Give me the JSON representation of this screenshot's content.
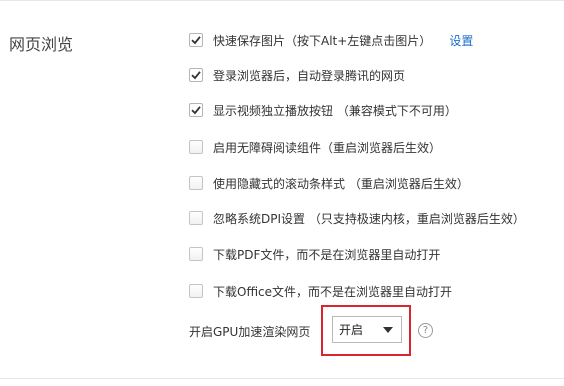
{
  "section": {
    "title": "网页浏览"
  },
  "options": [
    {
      "label": "快速保存图片（按下Alt+左键点击图片）",
      "checked": true,
      "link": "设置"
    },
    {
      "label": "登录浏览器后，自动登录腾讯的网页",
      "checked": true
    },
    {
      "label": "显示视频独立播放按钮 （兼容模式下不可用）",
      "checked": true
    },
    {
      "label": "启用无障碍阅读组件（重启浏览器后生效）",
      "checked": false
    },
    {
      "label": "使用隐藏式的滚动条样式 （重启浏览器后生效）",
      "checked": false
    },
    {
      "label": "忽略系统DPI设置 （只支持极速内核，重启浏览器后生效）",
      "checked": false
    },
    {
      "label": "下载PDF文件，而不是在浏览器里自动打开",
      "checked": false
    },
    {
      "label": "下载Office文件，而不是在浏览器里自动打开",
      "checked": false
    }
  ],
  "gpu": {
    "label": "开启GPU加速渲染网页",
    "selected": "开启",
    "help_symbol": "?"
  },
  "colors": {
    "link": "#1a6dc9",
    "highlight": "#d9262e"
  },
  "icons": {
    "checkbox_check": "check-icon",
    "dropdown": "chevron-down-icon",
    "help": "help-icon"
  }
}
